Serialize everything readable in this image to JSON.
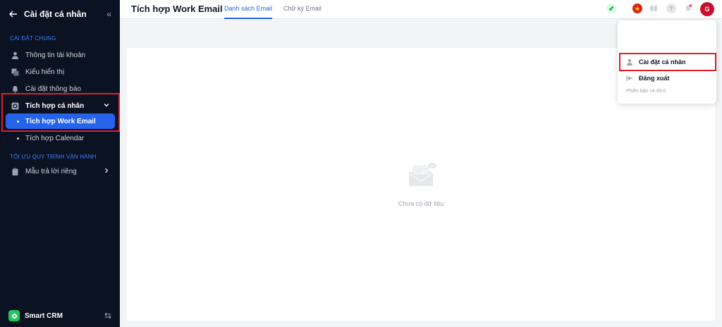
{
  "sidebar": {
    "title": "Cài đặt cá nhân",
    "section_general": "CÀI ĐẶT CHUNG",
    "items": [
      {
        "label": "Thông tin tài khoản"
      },
      {
        "label": "Kiểu hiển thị"
      },
      {
        "label": "Cài đặt thông báo"
      },
      {
        "label": "Tích hợp cá nhân"
      }
    ],
    "sub_items": [
      {
        "label": "Tích hợp Work Email"
      },
      {
        "label": "Tích hợp Calendar"
      }
    ],
    "section_process": "TỐI ƯU QUY TRÌNH VẬN HÀNH",
    "process_items": [
      {
        "label": "Mẫu trả lời riêng"
      }
    ],
    "footer": "Smart CRM"
  },
  "topbar": {
    "title": "Tích hợp Work Email",
    "tabs": [
      {
        "label": "Danh sách Email"
      },
      {
        "label": "Chữ ký Email"
      }
    ],
    "avatar_letter": "G"
  },
  "main": {
    "empty_text": "Chưa có dữ liệu"
  },
  "dropdown": {
    "items": [
      {
        "label": "Cài đặt cá nhân"
      },
      {
        "label": "Đăng xuất"
      }
    ],
    "version": "Phiên bản v4.49.0"
  },
  "colors": {
    "sidebar_bg": "#0b1221",
    "accent": "#2563eb",
    "highlight": "#e11d2a",
    "avatar": "#c8102e"
  }
}
